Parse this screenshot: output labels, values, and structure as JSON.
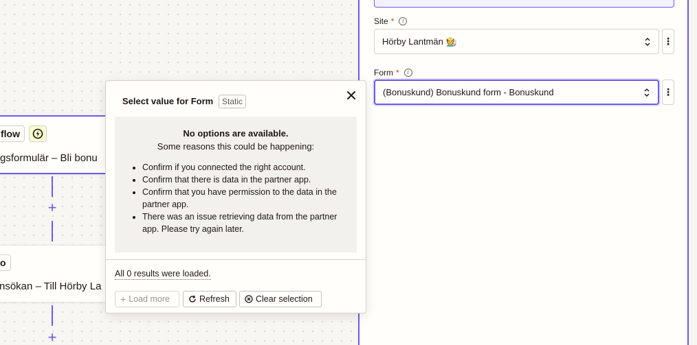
{
  "canvas": {
    "node1": {
      "chip": "flow",
      "title": "gsformulär – Bli bonu"
    },
    "node2": {
      "chip": "o",
      "title": "nsökan – Till Hörby La"
    }
  },
  "panel": {
    "site": {
      "label": "Site",
      "required": "*",
      "info": "i",
      "value": "Hörby Lantmän 🧑‍🌾",
      "menu": "⋮"
    },
    "form": {
      "label": "Form",
      "required": "*",
      "info": "i",
      "value": "(Bonuskund) Bonuskund form - Bonuskund",
      "menu": "⋮"
    }
  },
  "popover": {
    "title": "Select value for Form",
    "tag": "Static",
    "message_heading": "No options are available.",
    "message_sub": "Some reasons this could be happening:",
    "reasons": [
      "Confirm if you connected the right account.",
      "Confirm that there is data in the partner app.",
      "Confirm that you have permission to the data in the partner app.",
      "There was an issue retrieving data from the partner app. Please try again later."
    ],
    "results_text": "All 0 results were loaded.",
    "buttons": {
      "load_more": "Load more",
      "refresh": "Refresh",
      "clear_selection": "Clear selection"
    }
  },
  "colors": {
    "accent": "#695be8",
    "background": "#f7f6f2",
    "zap_chip": "#f6fccf",
    "required": "#d0421b"
  },
  "icons": [
    "zap-icon",
    "plus-icon",
    "info-icon",
    "chevron-updown-icon",
    "kebab-icon",
    "close-icon",
    "refresh-icon",
    "clear-circle-icon"
  ]
}
